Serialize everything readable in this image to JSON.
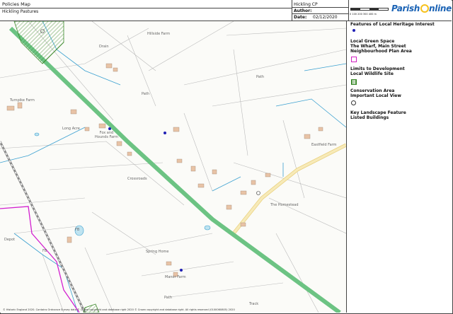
{
  "header": {
    "map_title": "Policies Map",
    "map_subtitle": "Hickling Pastures",
    "parish": "Hickling CP",
    "author_label": "Author:",
    "author_value": "",
    "date_label": "Date:",
    "date_value": "02/12/2020",
    "logo_before": "Parish",
    "logo_after": "nline",
    "scale_text": "0   100   200   300   400 m"
  },
  "legend": {
    "items": [
      {
        "label": "Features of Local Heritage Interest",
        "symbol": "dot",
        "color": "#1f1fb4"
      },
      {
        "label": "Local Green Space\nThe Wharf, Main Street\nNeighbourhood Plan Area",
        "symbol": "square-outline",
        "color": "#d020c0"
      },
      {
        "label": "Limits to Development\nLocal Wildlife Site",
        "symbol": "hatched-square",
        "color": "#3c8a2c"
      },
      {
        "label": "Conservation Area\nImportant Local View",
        "symbol": "circle",
        "color": "#333333"
      },
      {
        "label": "Key Landscape Feature\nListed Buildings",
        "symbol": "none",
        "color": ""
      }
    ]
  },
  "map": {
    "labels": {
      "hillside_farm": "Hillside Farm",
      "turnpike_farm": "Turnpike Farm",
      "long_acre": "Long Acre",
      "fox_hounds": "Fox and\nHounds Farm",
      "crossroads": "Crossroads",
      "easthill_farm": "Eastfield Farm",
      "homestead": "The Homestead",
      "spring_home": "Spring Home",
      "manor_farm": "Manor Farm",
      "depot": "Depot",
      "fb1": "FB",
      "fb2": "FB",
      "path1": "Path",
      "path2": "Path",
      "path3": "Path",
      "drain": "Drain",
      "track": "Track"
    },
    "copyright": "© Historic England 2020. Contains Ordnance Survey data © Crown copyright and database right 2020 © Crown copyright and database right. All rights reserved (0100060805) 2020",
    "colors": {
      "road_green": "#7fcc8f",
      "main_road": "#f3e2a4",
      "water": "#3aa0d0",
      "boundary": "#d21fcf",
      "building": "#e8c3a6",
      "heritage_dot": "#1f1fb4",
      "wildlife": "#3c8a2c"
    }
  }
}
